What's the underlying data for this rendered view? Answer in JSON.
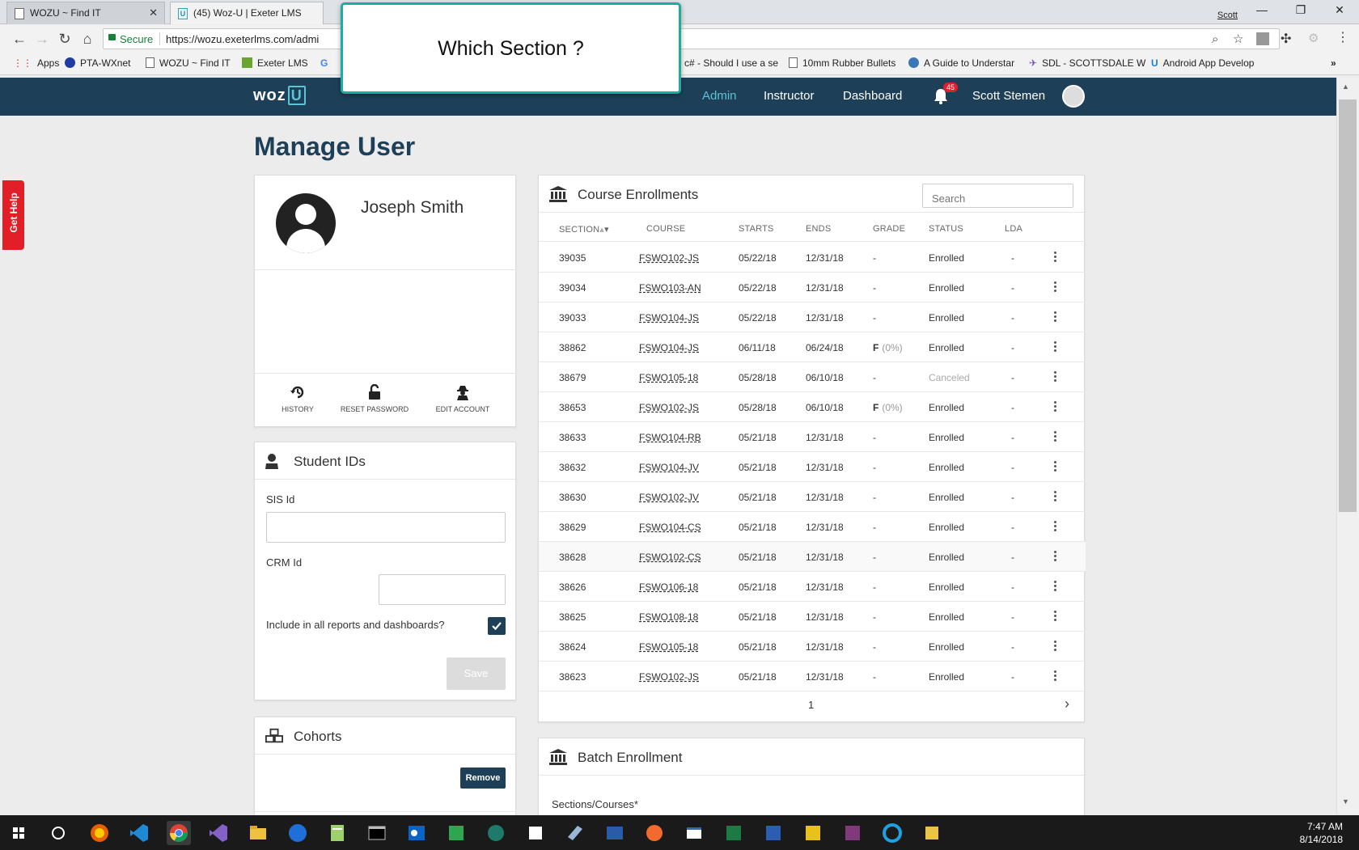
{
  "browser": {
    "tabs": [
      {
        "title": "WOZU ~ Find IT"
      },
      {
        "title": "(45) Woz-U | Exeter LMS"
      }
    ],
    "window_user": "Scott",
    "secure_label": "Secure",
    "url": "https://wozu.exeterlms.com/admi",
    "bookmarks": [
      "Apps",
      "PTA-WXnet",
      "WOZU ~ Find IT",
      "Exeter LMS",
      "c# - Should I use a se",
      "10mm Rubber Bullets",
      "A Guide to Understar",
      "SDL - SCOTTSDALE W",
      "Android App Develop"
    ]
  },
  "callout": {
    "text": "Which Section ?"
  },
  "nav": {
    "logo_text": "woz",
    "logo_u": "U",
    "admin": "Admin",
    "instructor": "Instructor",
    "dashboard": "Dashboard",
    "notif_count": "45",
    "user_name": "Scott Stemen"
  },
  "get_help": "Get Help",
  "page": {
    "title": "Manage User"
  },
  "profile": {
    "name": "Joseph Smith",
    "actions": {
      "history": "HISTORY",
      "reset_password": "RESET PASSWORD",
      "edit_account": "EDIT ACCOUNT"
    }
  },
  "student_ids": {
    "title": "Student IDs",
    "sis_label": "SIS Id",
    "sis_value": "",
    "crm_label": "CRM Id",
    "crm_value": "",
    "include_label": "Include in all reports and dashboards?",
    "include_checked": true,
    "save": "Save"
  },
  "cohorts": {
    "title": "Cohorts",
    "remove": "Remove"
  },
  "enrollments": {
    "title": "Course Enrollments",
    "search_placeholder": "Search",
    "columns": {
      "section": "SECTION",
      "course": "COURSE",
      "starts": "STARTS",
      "ends": "ENDS",
      "grade": "GRADE",
      "status": "STATUS",
      "lda": "LDA"
    },
    "rows": [
      {
        "section": "39035",
        "course": "FSWO102-JS",
        "starts": "05/22/18",
        "ends": "12/31/18",
        "grade": "-",
        "pct": "",
        "status": "Enrolled",
        "lda": "-"
      },
      {
        "section": "39034",
        "course": "FSWO103-AN",
        "starts": "05/22/18",
        "ends": "12/31/18",
        "grade": "-",
        "pct": "",
        "status": "Enrolled",
        "lda": "-"
      },
      {
        "section": "39033",
        "course": "FSWO104-JS",
        "starts": "05/22/18",
        "ends": "12/31/18",
        "grade": "-",
        "pct": "",
        "status": "Enrolled",
        "lda": "-"
      },
      {
        "section": "38862",
        "course": "FSWO104-JS",
        "starts": "06/11/18",
        "ends": "06/24/18",
        "grade": "F",
        "pct": "(0%)",
        "status": "Enrolled",
        "lda": "-"
      },
      {
        "section": "38679",
        "course": "FSWO105-18",
        "starts": "05/28/18",
        "ends": "06/10/18",
        "grade": "-",
        "pct": "",
        "status": "Canceled",
        "lda": "-"
      },
      {
        "section": "38653",
        "course": "FSWO102-JS",
        "starts": "05/28/18",
        "ends": "06/10/18",
        "grade": "F",
        "pct": "(0%)",
        "status": "Enrolled",
        "lda": "-"
      },
      {
        "section": "38633",
        "course": "FSWO104-RB",
        "starts": "05/21/18",
        "ends": "12/31/18",
        "grade": "-",
        "pct": "",
        "status": "Enrolled",
        "lda": "-"
      },
      {
        "section": "38632",
        "course": "FSWO104-JV",
        "starts": "05/21/18",
        "ends": "12/31/18",
        "grade": "-",
        "pct": "",
        "status": "Enrolled",
        "lda": "-"
      },
      {
        "section": "38630",
        "course": "FSWO102-JV",
        "starts": "05/21/18",
        "ends": "12/31/18",
        "grade": "-",
        "pct": "",
        "status": "Enrolled",
        "lda": "-"
      },
      {
        "section": "38629",
        "course": "FSWO104-CS",
        "starts": "05/21/18",
        "ends": "12/31/18",
        "grade": "-",
        "pct": "",
        "status": "Enrolled",
        "lda": "-"
      },
      {
        "section": "38628",
        "course": "FSWO102-CS",
        "starts": "05/21/18",
        "ends": "12/31/18",
        "grade": "-",
        "pct": "",
        "status": "Enrolled",
        "lda": "-"
      },
      {
        "section": "38626",
        "course": "FSWO106-18",
        "starts": "05/21/18",
        "ends": "12/31/18",
        "grade": "-",
        "pct": "",
        "status": "Enrolled",
        "lda": "-"
      },
      {
        "section": "38625",
        "course": "FSWO108-18",
        "starts": "05/21/18",
        "ends": "12/31/18",
        "grade": "-",
        "pct": "",
        "status": "Enrolled",
        "lda": "-"
      },
      {
        "section": "38624",
        "course": "FSWO105-18",
        "starts": "05/21/18",
        "ends": "12/31/18",
        "grade": "-",
        "pct": "",
        "status": "Enrolled",
        "lda": "-"
      },
      {
        "section": "38623",
        "course": "FSWO102-JS",
        "starts": "05/21/18",
        "ends": "12/31/18",
        "grade": "-",
        "pct": "",
        "status": "Enrolled",
        "lda": "-"
      }
    ],
    "page": "1"
  },
  "batch": {
    "title": "Batch Enrollment",
    "sections_label": "Sections/Courses*"
  },
  "taskbar": {
    "time": "7:47 AM",
    "date": "8/14/2018"
  },
  "colors": {
    "navy": "#1d3f58",
    "teal": "#5fc3d6",
    "callout_border": "#1aaea0",
    "help_red": "#e21f26"
  }
}
